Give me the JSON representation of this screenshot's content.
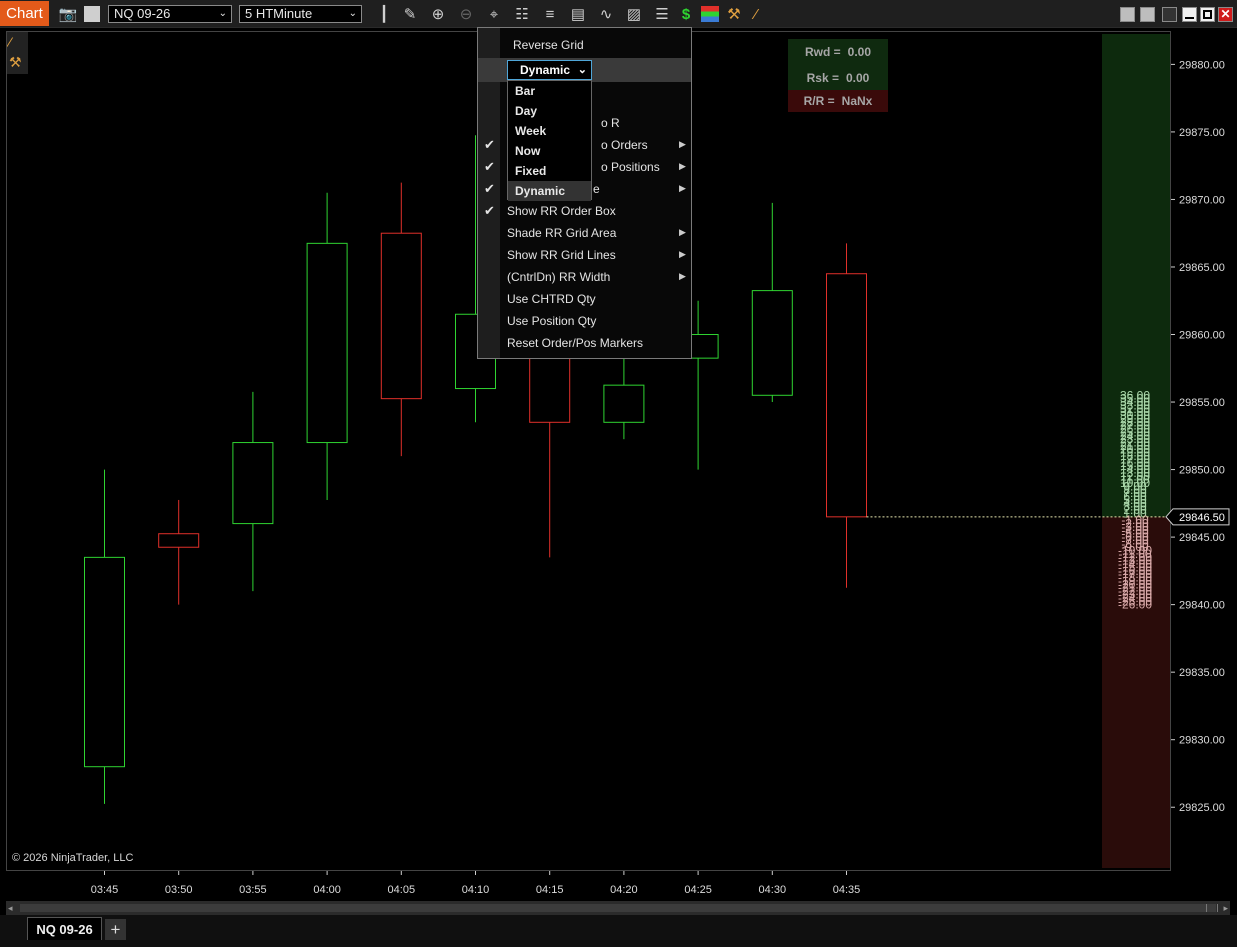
{
  "toolbar": {
    "chart_tab": "Chart",
    "instrument": "NQ 09-26",
    "interval": "5 HTMinute",
    "icons": [
      "camera-icon",
      "color-box-icon",
      "bar-type-icon",
      "pencil-icon",
      "zoom-in-icon",
      "zoom-out-icon",
      "crosshair-icon",
      "properties-icon",
      "templates-icon",
      "data-box-icon",
      "indicators-icon",
      "strategies-icon",
      "objects-list-icon",
      "chart-trader-icon",
      "color-bars-icon",
      "tool-icon",
      "ruler-icon"
    ],
    "window_buttons": [
      "tile-icon",
      "tile-icon",
      "minimize-icon",
      "maximize-icon",
      "close-icon"
    ]
  },
  "context_menu": {
    "items": [
      {
        "label": "Reverse Grid",
        "checked": false,
        "submenu": false
      },
      {
        "label": "Show RR Order Box",
        "checked": true,
        "submenu": false
      },
      {
        "label": "Shade RR Grid Area",
        "checked": false,
        "submenu": true
      },
      {
        "label": "Show RR Grid Lines",
        "checked": false,
        "submenu": true
      },
      {
        "label": "(CntrlDn) RR Width",
        "checked": false,
        "submenu": true
      },
      {
        "label": "Use CHTRD Qty",
        "checked": false,
        "submenu": false
      },
      {
        "label": "Use Position Qty",
        "checked": false,
        "submenu": false
      },
      {
        "label": "Reset Order/Pos Markers",
        "checked": false,
        "submenu": false
      }
    ],
    "partial_items": [
      "o R",
      "o Orders",
      "o Positions",
      "e"
    ],
    "mode_select": "Dynamic",
    "mode_options": [
      "Bar",
      "Day",
      "Week",
      "Now",
      "Fixed",
      "Dynamic"
    ],
    "mode_selected_index": 5
  },
  "rr_box": {
    "reward_label": "Rwd =",
    "reward_value": "0.00",
    "risk_label": "Rsk =",
    "risk_value": "0.00",
    "ratio_label": "R/R =",
    "ratio_value": "NaNx"
  },
  "copyright": "© 2026 NinjaTrader, LLC",
  "bottom_tabs": {
    "instrument_tab": "NQ 09-26",
    "add_tab": "+"
  },
  "colors": {
    "up": "#2fd431",
    "down": "#e0302a",
    "chart_tab": "#e35a1a",
    "reward_zone": "#0d2a0d",
    "risk_zone": "#2a0c0a",
    "reward_text": "#a9d6a9",
    "risk_text": "#d8a8a8",
    "price_marker": "#e8e8b0"
  },
  "chart_data": {
    "type": "candlestick",
    "x": [
      "03:45",
      "03:50",
      "03:55",
      "04:00",
      "04:05",
      "04:10",
      "04:15",
      "04:20",
      "04:25",
      "04:30",
      "04:35"
    ],
    "open": [
      29828.0,
      29845.25,
      29846.0,
      29852.0,
      29867.5,
      29856.0,
      29859.25,
      29853.5,
      29858.25,
      29855.5,
      29864.5
    ],
    "high": [
      29850.0,
      29847.75,
      29855.75,
      29870.5,
      29871.25,
      29874.75,
      29860.5,
      29858.75,
      29862.5,
      29869.75,
      29866.75
    ],
    "low": [
      29825.25,
      29840.0,
      29841.0,
      29847.75,
      29851.0,
      29853.5,
      29843.5,
      29852.25,
      29850.0,
      29855.0,
      29841.25
    ],
    "close": [
      29843.5,
      29844.25,
      29852.0,
      29866.75,
      29855.25,
      29861.5,
      29853.5,
      29856.25,
      29860.0,
      29863.25,
      29846.5
    ],
    "direction": [
      "up",
      "down",
      "up",
      "up",
      "down",
      "up",
      "down",
      "up",
      "up",
      "up",
      "down"
    ],
    "price_ticks": [
      "29880.00",
      "29875.00",
      "29870.00",
      "29865.00",
      "29860.00",
      "29855.00",
      "29850.00",
      "29845.00",
      "29840.00",
      "29835.00",
      "29830.00",
      "29825.00"
    ],
    "current_price": "29846.50",
    "ylim": [
      29820.5,
      29882.25
    ],
    "rr_grid": {
      "reward_levels": [
        "36.00",
        "35.00",
        "34.00",
        "33.00",
        "32.00",
        "31.00",
        "30.00",
        "29.00",
        "28.00",
        "27.00",
        "26.00",
        "25.00",
        "24.00",
        "23.00",
        "22.00",
        "21.00",
        "20.00",
        "19.00",
        "18.00",
        "17.00",
        "16.00",
        "15.00",
        "14.00",
        "13.00",
        "12.00",
        "11.00",
        "10.00",
        "9.00",
        "8.00",
        "7.00",
        "6.00",
        "5.00",
        "4.00",
        "3.00",
        "2.00",
        "1.00"
      ],
      "risk_levels": [
        "-1.00",
        "-2.00",
        "-3.00",
        "-4.00",
        "-5.00",
        "-6.00",
        "-7.00",
        "-8.00",
        "-9.00",
        "-10.00",
        "-11.00",
        "-12.00",
        "-13.00",
        "-14.00",
        "-15.00",
        "-16.00",
        "-17.00",
        "-18.00",
        "-19.00",
        "-20.00",
        "-21.00",
        "-22.00",
        "-23.00",
        "-24.00",
        "-25.00",
        "-26.00"
      ]
    }
  }
}
